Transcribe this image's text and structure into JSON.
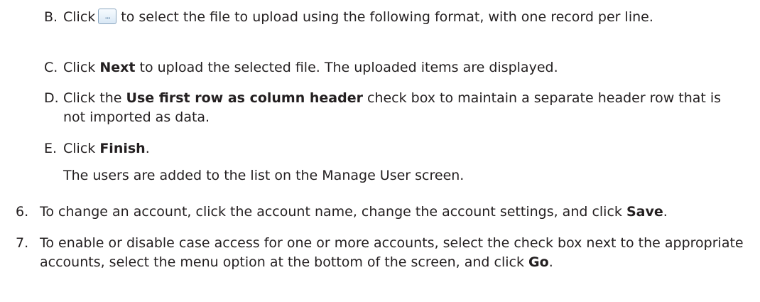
{
  "steps": {
    "b": {
      "marker": "B.",
      "pre": "Click",
      "button_label": "...",
      "post": "to select the file to upload using the following format, with one record per line."
    },
    "c": {
      "marker": "C.",
      "pre": "Click ",
      "bold": "Next",
      "post": " to upload the selected file. The uploaded items are displayed."
    },
    "d": {
      "marker": "D.",
      "pre": "Click the ",
      "bold": "Use first row as column header",
      "post": " check box to maintain a separate header row that is not imported as data."
    },
    "e": {
      "marker": "E.",
      "pre": "Click ",
      "bold": "Finish",
      "post": ".",
      "result": "The users are added to the list on the Manage User screen."
    },
    "six": {
      "marker": "6.",
      "pre": "To change an account, click the account name, change the account settings, and click ",
      "bold": "Save",
      "post": "."
    },
    "seven": {
      "marker": "7.",
      "pre": "To enable or disable case access for one or more accounts, select the check box next to the appropriate accounts, select the menu option at the bottom of the screen, and click ",
      "bold": "Go",
      "post": "."
    }
  }
}
